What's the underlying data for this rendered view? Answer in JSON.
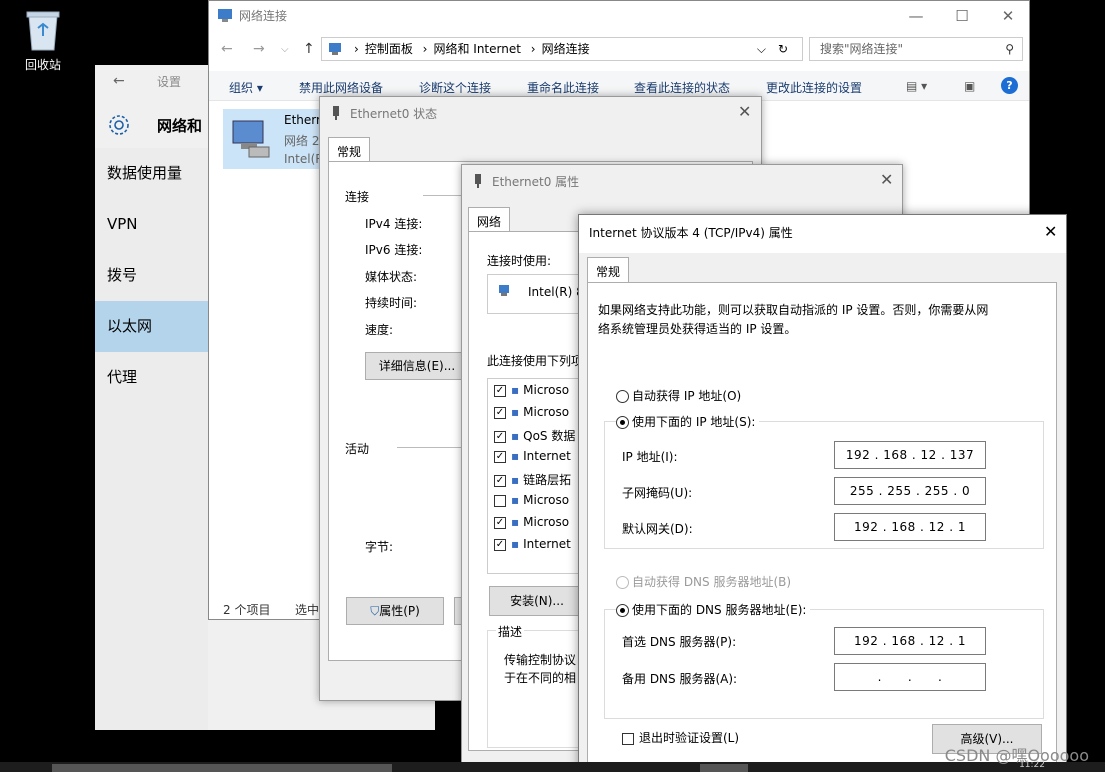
{
  "desktop": {
    "recycle_label": "回收站",
    "watermark": "CSDN @嘿Oooooo",
    "clock": "11:22"
  },
  "settings": {
    "title": "设置",
    "header": "网络和",
    "items": [
      {
        "label": "数据使用量"
      },
      {
        "label": "VPN"
      },
      {
        "label": "拨号"
      },
      {
        "label": "以太网"
      },
      {
        "label": "代理"
      }
    ]
  },
  "explorer": {
    "title": "网络连接",
    "breadcrumb": [
      "控制面板",
      "网络和 Internet",
      "网络连接"
    ],
    "search_placeholder": "搜索\"网络连接\"",
    "commands": [
      "组织 ▾",
      "禁用此网络设备",
      "诊断这个连接",
      "重命名此连接",
      "查看此连接的状态",
      "更改此连接的设置"
    ],
    "item_name": "Etherr",
    "item_sub": "网络 2",
    "item_sub2": "Intel(R",
    "status_left": "2 个项目",
    "status_right": "选中"
  },
  "status_dialog": {
    "title": "Ethernet0 状态",
    "tab": "常规",
    "section_connect": "连接",
    "rows": [
      "IPv4 连接:",
      "IPv6 连接:",
      "媒体状态:",
      "持续时间:",
      "速度:"
    ],
    "details_btn": "详细信息(E)...",
    "section_activity": "活动",
    "bytes_label": "字节:",
    "props_btn": "属性(P)"
  },
  "props_dialog": {
    "title": "Ethernet0 属性",
    "tab": "网络",
    "connect_using": "连接时使用:",
    "adapter": "Intel(R) 8",
    "uses_items": "此连接使用下列项",
    "components": [
      {
        "label": "Microso",
        "checked": true
      },
      {
        "label": "Microso",
        "checked": true
      },
      {
        "label": "QoS 数据",
        "checked": true
      },
      {
        "label": "Internet",
        "checked": true
      },
      {
        "label": "链路层拓",
        "checked": true
      },
      {
        "label": "Microso",
        "checked": false
      },
      {
        "label": "Microso",
        "checked": true
      },
      {
        "label": "Internet",
        "checked": true
      }
    ],
    "install_btn": "安装(N)...",
    "desc_title": "描述",
    "desc_line1": "传输控制协议",
    "desc_line2": "于在不同的相"
  },
  "ipv4_dialog": {
    "title": "Internet 协议版本 4 (TCP/IPv4) 属性",
    "tab": "常规",
    "intro_line1": "如果网络支持此功能，则可以获取自动指派的 IP 设置。否则，你需要从网",
    "intro_line2": "络系统管理员处获得适当的 IP 设置。",
    "auto_ip": "自动获得 IP 地址(O)",
    "manual_ip": "使用下面的 IP 地址(S):",
    "ip_label": "IP 地址(I):",
    "ip_value": "192 . 168 . 12 . 137",
    "mask_label": "子网掩码(U):",
    "mask_value": "255 . 255 . 255 .  0",
    "gw_label": "默认网关(D):",
    "gw_value": "192 . 168 . 12 .  1",
    "auto_dns": "自动获得 DNS 服务器地址(B)",
    "manual_dns": "使用下面的 DNS 服务器地址(E):",
    "dns1_label": "首选 DNS 服务器(P):",
    "dns1_value": "192 . 168 . 12 .  1",
    "dns2_label": "备用 DNS 服务器(A):",
    "dns2_value": "     .      .      .     ",
    "validate": "退出时验证设置(L)",
    "advanced_btn": "高级(V)..."
  }
}
